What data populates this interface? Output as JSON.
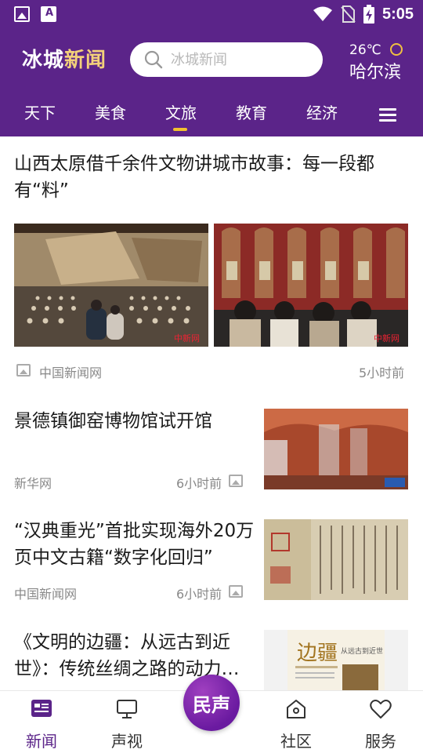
{
  "status_bar": {
    "time": "5:05"
  },
  "header": {
    "logo_part1": "冰城",
    "logo_part2": "新闻",
    "search_placeholder": "冰城新闻",
    "weather": {
      "temperature": "26℃",
      "city": "哈尔滨",
      "icon": "sun-icon"
    },
    "tabs": [
      {
        "label": "天下"
      },
      {
        "label": "美食"
      },
      {
        "label": "文旅",
        "active": true
      },
      {
        "label": "教育"
      },
      {
        "label": "经济"
      }
    ]
  },
  "feed": [
    {
      "title": "山西太原借千余件文物讲城市故事：每一段都有“料”",
      "source": "中国新闻网",
      "time": "5小时前",
      "watermark1": "中新网",
      "watermark2": "中新网"
    },
    {
      "title": "景德镇御窑博物馆试开馆",
      "source": "新华网",
      "time": "6小时前"
    },
    {
      "title": "“汉典重光”首批实现海外20万页中文古籍“数字化回归”",
      "source": "中国新闻网",
      "time": "6小时前"
    },
    {
      "title": "《文明的边疆：从远古到近世》：传统丝绸之路的动力…",
      "cover_title": "边疆",
      "cover_subtitle": "从远古到近世"
    }
  ],
  "bottom_nav": {
    "items": [
      {
        "label": "新闻",
        "icon": "news-icon",
        "active": true
      },
      {
        "label": "声视",
        "icon": "monitor-icon"
      },
      {
        "label": "社区",
        "icon": "home-icon"
      },
      {
        "label": "服务",
        "icon": "heart-icon"
      }
    ],
    "center_label": "民声"
  },
  "colors": {
    "brand": "#5b2489",
    "tab_indicator": "#f2c12e",
    "meta_text": "#888888"
  }
}
